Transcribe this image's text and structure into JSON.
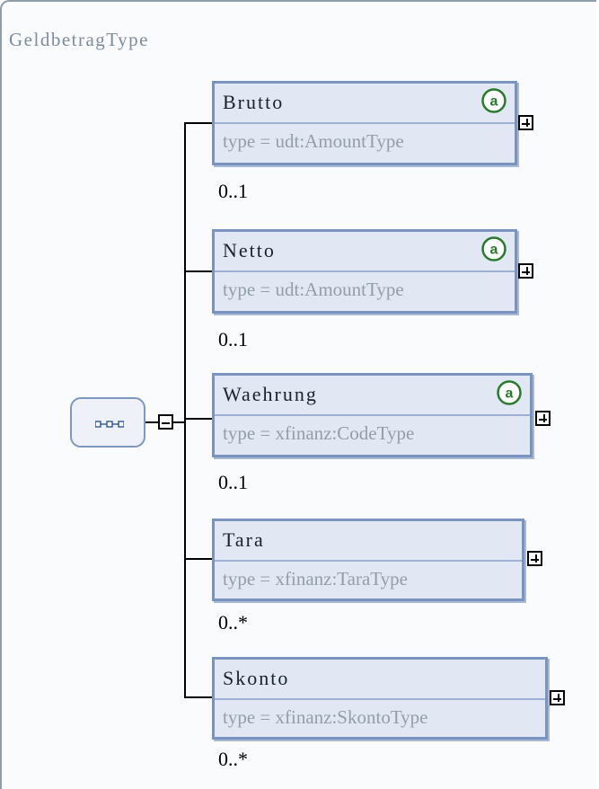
{
  "type_name": "GeldbetragType",
  "icons": {
    "sequence": "sequence-compositor-icon",
    "attribute": "attribute-a-icon",
    "expand": "plus-box-icon",
    "collapse": "minus-box-icon"
  },
  "colors": {
    "element_fill": "#e2e8f3",
    "element_border": "#7b93bf",
    "attribute_icon": "#2a7a2e",
    "type_text": "#939eab"
  },
  "elements": [
    {
      "name": "Brutto",
      "type": "type = udt:AmountType",
      "cardinality": "0..1",
      "has_attributes": true
    },
    {
      "name": "Netto",
      "type": "type = udt:AmountType",
      "cardinality": "0..1",
      "has_attributes": true
    },
    {
      "name": "Waehrung",
      "type": "type = xfinanz:CodeType",
      "cardinality": "0..1",
      "has_attributes": true
    },
    {
      "name": "Tara",
      "type": "type = xfinanz:TaraType",
      "cardinality": "0..*",
      "has_attributes": false
    },
    {
      "name": "Skonto",
      "type": "type = xfinanz:SkontoType",
      "cardinality": "0..*",
      "has_attributes": false
    }
  ]
}
